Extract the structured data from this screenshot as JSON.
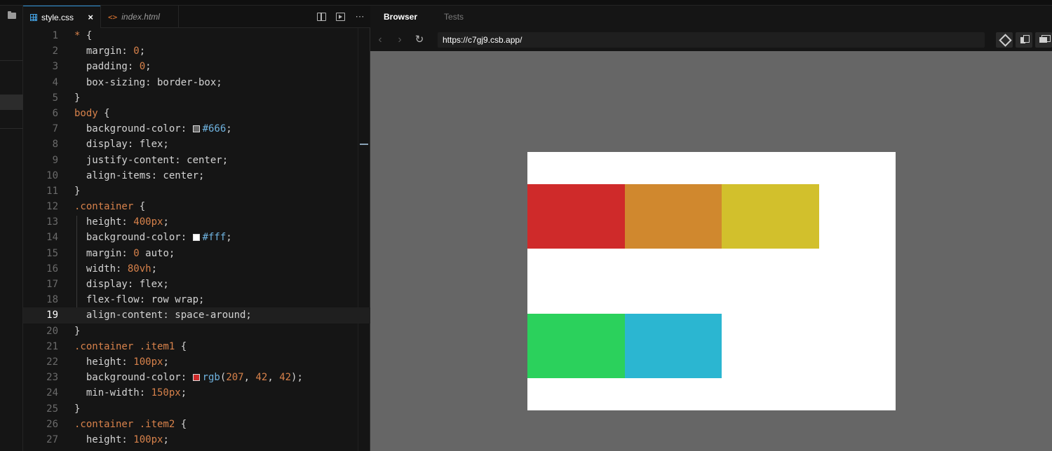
{
  "editor": {
    "tabs": [
      {
        "label": "style.css",
        "active": true
      },
      {
        "label": "index.html",
        "active": false
      }
    ],
    "current_line": 19,
    "lines": [
      [
        [
          "sel",
          "* "
        ],
        [
          "prop",
          "{"
        ]
      ],
      [
        [
          "prop",
          "  margin: "
        ],
        [
          "num",
          "0"
        ],
        [
          "prop",
          ";"
        ]
      ],
      [
        [
          "prop",
          "  padding: "
        ],
        [
          "num",
          "0"
        ],
        [
          "prop",
          ";"
        ]
      ],
      [
        [
          "prop",
          "  box-sizing: border-box;"
        ]
      ],
      [
        [
          "prop",
          "}"
        ]
      ],
      [
        [
          "sel",
          "body "
        ],
        [
          "prop",
          "{"
        ]
      ],
      [
        [
          "prop",
          "  background-color: "
        ],
        [
          "swatch",
          "#666666"
        ],
        [
          "hex",
          "#666"
        ],
        [
          "prop",
          ";"
        ]
      ],
      [
        [
          "prop",
          "  display: flex;"
        ]
      ],
      [
        [
          "prop",
          "  justify-content: center;"
        ]
      ],
      [
        [
          "prop",
          "  align-items: center;"
        ]
      ],
      [
        [
          "prop",
          "}"
        ]
      ],
      [
        [
          "sel",
          ".container "
        ],
        [
          "prop",
          "{"
        ]
      ],
      [
        [
          "prop",
          "  height: "
        ],
        [
          "num",
          "400px"
        ],
        [
          "prop",
          ";"
        ]
      ],
      [
        [
          "prop",
          "  background-color: "
        ],
        [
          "swatch",
          "#ffffff"
        ],
        [
          "hex",
          "#fff"
        ],
        [
          "prop",
          ";"
        ]
      ],
      [
        [
          "prop",
          "  margin: "
        ],
        [
          "num",
          "0"
        ],
        [
          "prop",
          " auto;"
        ]
      ],
      [
        [
          "prop",
          "  width: "
        ],
        [
          "num",
          "80vh"
        ],
        [
          "prop",
          ";"
        ]
      ],
      [
        [
          "prop",
          "  display: flex;"
        ]
      ],
      [
        [
          "prop",
          "  flex-flow: row wrap;"
        ]
      ],
      [
        [
          "prop",
          "  align-content: space-around;"
        ]
      ],
      [
        [
          "prop",
          "}"
        ]
      ],
      [
        [
          "sel",
          ".container .item1 "
        ],
        [
          "prop",
          "{"
        ]
      ],
      [
        [
          "prop",
          "  height: "
        ],
        [
          "num",
          "100px"
        ],
        [
          "prop",
          ";"
        ]
      ],
      [
        [
          "prop",
          "  background-color: "
        ],
        [
          "swatch",
          "#cf2a2a"
        ],
        [
          "fn",
          "rgb"
        ],
        [
          "prop",
          "("
        ],
        [
          "num",
          "207"
        ],
        [
          "prop",
          ", "
        ],
        [
          "num",
          "42"
        ],
        [
          "prop",
          ", "
        ],
        [
          "num",
          "42"
        ],
        [
          "prop",
          ");"
        ]
      ],
      [
        [
          "prop",
          "  min-width: "
        ],
        [
          "num",
          "150px"
        ],
        [
          "prop",
          ";"
        ]
      ],
      [
        [
          "prop",
          "}"
        ]
      ],
      [
        [
          "sel",
          ".container .item2 "
        ],
        [
          "prop",
          "{"
        ]
      ],
      [
        [
          "prop",
          "  height: "
        ],
        [
          "num",
          "100px"
        ],
        [
          "prop",
          ";"
        ]
      ]
    ]
  },
  "browser": {
    "tabs": [
      {
        "label": "Browser",
        "active": true
      },
      {
        "label": "Tests",
        "active": false
      }
    ],
    "url": "https://c7gj9.csb.app/",
    "preview_items": [
      {
        "name": "item1",
        "color": "#cf2a2a",
        "row": 0,
        "col": 0
      },
      {
        "name": "item2",
        "color": "#d0882e",
        "row": 0,
        "col": 1
      },
      {
        "name": "item3",
        "color": "#d2c02c",
        "row": 0,
        "col": 2
      },
      {
        "name": "item4",
        "color": "#2bd15c",
        "row": 1,
        "col": 0
      },
      {
        "name": "item5",
        "color": "#2bb6d1",
        "row": 1,
        "col": 1
      }
    ]
  },
  "colors": {
    "accent": "#2a8fd6",
    "page_bg": "#666666",
    "container_bg": "#ffffff"
  }
}
